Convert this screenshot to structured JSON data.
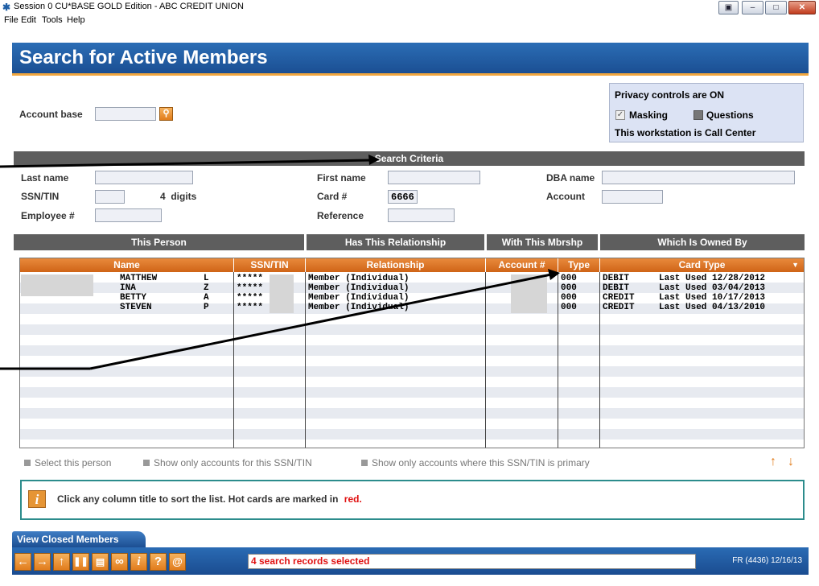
{
  "window": {
    "title": "Session 0 CU*BASE GOLD Edition - ABC CREDIT UNION",
    "menu": [
      "File",
      "Edit",
      "Tools",
      "Help"
    ]
  },
  "page_title": "Search for Active Members",
  "account_base": {
    "label": "Account base",
    "value": ""
  },
  "privacy": {
    "line1": "Privacy controls are ON",
    "masking_label": "Masking",
    "masking_checked": true,
    "questions_label": "Questions",
    "questions_checked": false,
    "line3": "This workstation is Call Center"
  },
  "search_criteria": {
    "title": "Search Criteria",
    "last_name_label": "Last name",
    "last_name_value": "",
    "first_name_label": "First name",
    "first_name_value": "",
    "dba_label": "DBA name",
    "dba_value": "",
    "ssn_label": "SSN/TIN",
    "ssn_value": "",
    "ssn_digits": "4  digits",
    "card_label": "Card #",
    "card_value": "6666",
    "account_label": "Account",
    "account_value": "",
    "employee_label": "Employee #",
    "employee_value": "",
    "reference_label": "Reference",
    "reference_value": ""
  },
  "groups": {
    "this_person": "This Person",
    "has_relationship": "Has This Relationship",
    "with_mbrshp": "With This Mbrshp",
    "owned_by": "Which Is Owned By"
  },
  "columns": {
    "name": "Name",
    "ssn": "SSN/TIN",
    "relationship": "Relationship",
    "account": "Account #",
    "type": "Type",
    "card_type": "Card Type"
  },
  "rows": [
    {
      "first": "MATTHEW",
      "mi": "L",
      "ssn": "*****",
      "relationship": "Member (Individual)",
      "type": "000",
      "card": "DEBIT",
      "last_used": "Last Used 12/28/2012"
    },
    {
      "first": "INA",
      "mi": "Z",
      "ssn": "*****",
      "relationship": "Member (Individual)",
      "type": "000",
      "card": "DEBIT",
      "last_used": "Last Used 03/04/2013"
    },
    {
      "first": "BETTY",
      "mi": "A",
      "ssn": "*****",
      "relationship": "Member (Individual)",
      "type": "000",
      "card": "CREDIT",
      "last_used": "Last Used 10/17/2013"
    },
    {
      "first": "STEVEN",
      "mi": "P",
      "ssn": "*****",
      "relationship": "Member (Individual)",
      "type": "000",
      "card": "CREDIT",
      "last_used": "Last Used 04/13/2010"
    }
  ],
  "options": {
    "select_person": "Select this person",
    "show_only_accounts": "Show only accounts for this SSN/TIN",
    "show_primary": "Show only accounts where this SSN/TIN is primary"
  },
  "info": {
    "text": "Click any column title to sort the list. Hot cards are marked in",
    "red_word": "red."
  },
  "closed_tab": "View Closed Members",
  "status_message": "4 search records selected",
  "footer_info": "FR (4436) 12/16/13",
  "colors": {
    "header_blue": "#1b4f93",
    "accent_orange": "#e17c1c",
    "gray_bar": "#5e5e5e",
    "teal_border": "#2c8c8c",
    "hot_red": "#e01010"
  }
}
